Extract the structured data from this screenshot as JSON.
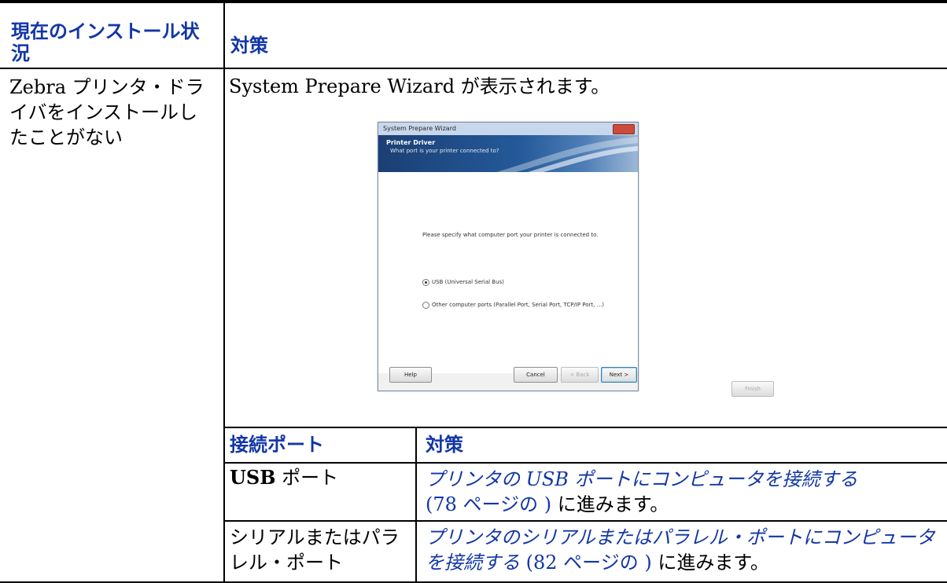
{
  "header": {
    "col1": "現在のインストール状況",
    "col2": "対策"
  },
  "row": {
    "condition_plain": "Zebra プリンタ・ドライバをインストー",
    "condition_tail_plain": "ル",
    "condition_bold": "したことがない",
    "action": "System Prepare Wizard が表示されます。"
  },
  "wizard": {
    "title": "System Prepare Wizard",
    "heading": "Printer Driver",
    "subheading": "What port is your printer connected to?",
    "prompt": "Please specify what computer port your printer is connected to.",
    "options": [
      {
        "label": "USB (Universal Serial Bus)",
        "selected": true
      },
      {
        "label": "Other computer ports (Parallel Port, Serial Port, TCP/IP Port, ...)",
        "selected": false
      }
    ],
    "buttons": {
      "help": "Help",
      "cancel": "Cancel",
      "back": "< Back",
      "next": "Next >",
      "finish": "Finish"
    }
  },
  "subtable": {
    "header": {
      "port": "接続ポート",
      "action": "対策"
    },
    "rows": [
      {
        "port_bold": "USB",
        "port_rest": " ポート",
        "link": "プリンタの USB ポートにコンピュータを接続する",
        "ref_paren_open": "(",
        "ref_page": "78 ページの",
        "ref_paren_close": " )",
        "tail": " に進みます。"
      },
      {
        "port": "シリアルまたはパラレル・ポート",
        "link": "プリンタのシリアルまたはパラレル・ポートにコンピュータを接続する",
        "ref_paren_open": " (",
        "ref_page": "82 ページの",
        "ref_paren_close": " )",
        "tail": " に進みます。"
      }
    ]
  },
  "colors": {
    "heading_blue": "#1236a6",
    "rule": "#000000"
  }
}
